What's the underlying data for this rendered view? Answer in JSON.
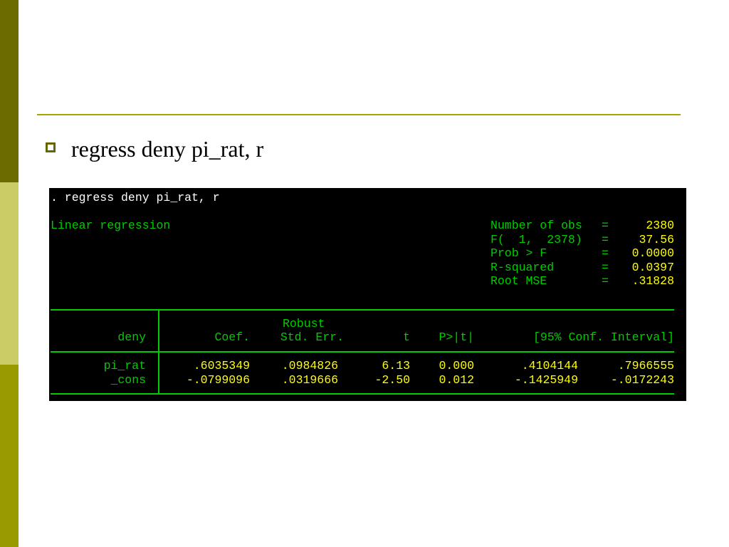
{
  "slide": {
    "bullet_text": "regress deny pi_rat, r"
  },
  "console": {
    "command": ". regress deny pi_rat, r",
    "model_title": "Linear regression",
    "stats": [
      {
        "label": "Number of obs",
        "eq": "=",
        "value": "2380"
      },
      {
        "label": "F(  1,  2378)",
        "eq": "=",
        "value": "37.56"
      },
      {
        "label": "Prob > F",
        "eq": "=",
        "value": "0.0000"
      },
      {
        "label": "R-squared",
        "eq": "=",
        "value": "0.0397"
      },
      {
        "label": "Root MSE",
        "eq": "=",
        "value": ".31828"
      }
    ],
    "header": {
      "depvar": "deny",
      "robust": "Robust",
      "coef": "Coef.",
      "stderr": "Std. Err.",
      "t": "t",
      "p": "P>|t|",
      "ci": "[95% Conf. Interval]"
    },
    "rows": [
      {
        "var": "pi_rat",
        "coef": ".6035349",
        "se": ".0984826",
        "t": "6.13",
        "p": "0.000",
        "lo": ".4104144",
        "hi": ".7966555"
      },
      {
        "var": "_cons",
        "coef": "-.0799096",
        "se": ".0319666",
        "t": "-2.50",
        "p": "0.012",
        "lo": "-.1425949",
        "hi": "-.0172243"
      }
    ]
  },
  "colors": {
    "sidebar_dark": "#6b6b00",
    "sidebar_light": "#cccc66",
    "sidebar_mid": "#999900",
    "rule": "#a6a600",
    "console_bg": "#000000",
    "console_green": "#00cc00",
    "console_yellow": "#ffff00",
    "console_white": "#ffffff"
  }
}
